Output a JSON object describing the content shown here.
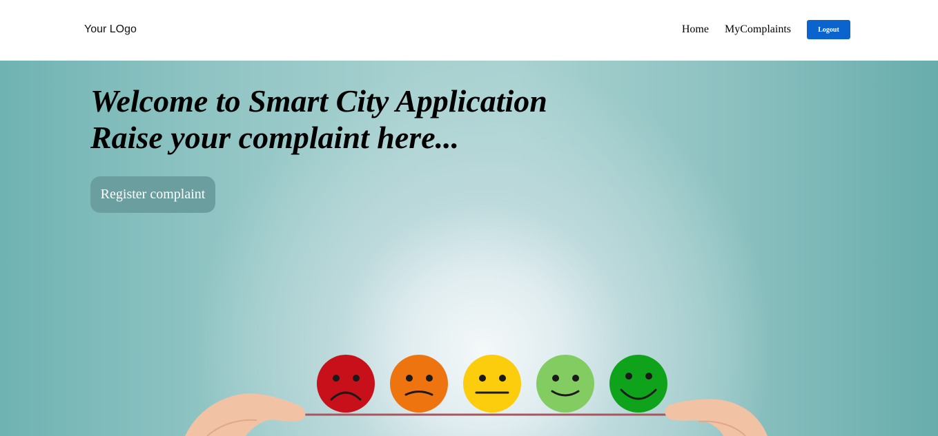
{
  "header": {
    "logo_text": "Your LOgo",
    "nav": {
      "home_label": "Home",
      "complaints_label": "MyComplaints",
      "logout_label": "Logout"
    }
  },
  "hero": {
    "headline_line1": "Welcome to Smart City Application",
    "headline_line2": "Raise your complaint here...",
    "register_button_label": "Register complaint",
    "illustration": {
      "faces": [
        {
          "mood": "very-sad",
          "color": "#c8101a"
        },
        {
          "mood": "sad",
          "color": "#ee7410"
        },
        {
          "mood": "neutral",
          "color": "#fbcd0c"
        },
        {
          "mood": "happy",
          "color": "#82cc62"
        },
        {
          "mood": "very-happy",
          "color": "#0ea31a"
        }
      ]
    }
  },
  "colors": {
    "logout_button": "#0b63ce",
    "register_button": "#6b9f9f"
  }
}
